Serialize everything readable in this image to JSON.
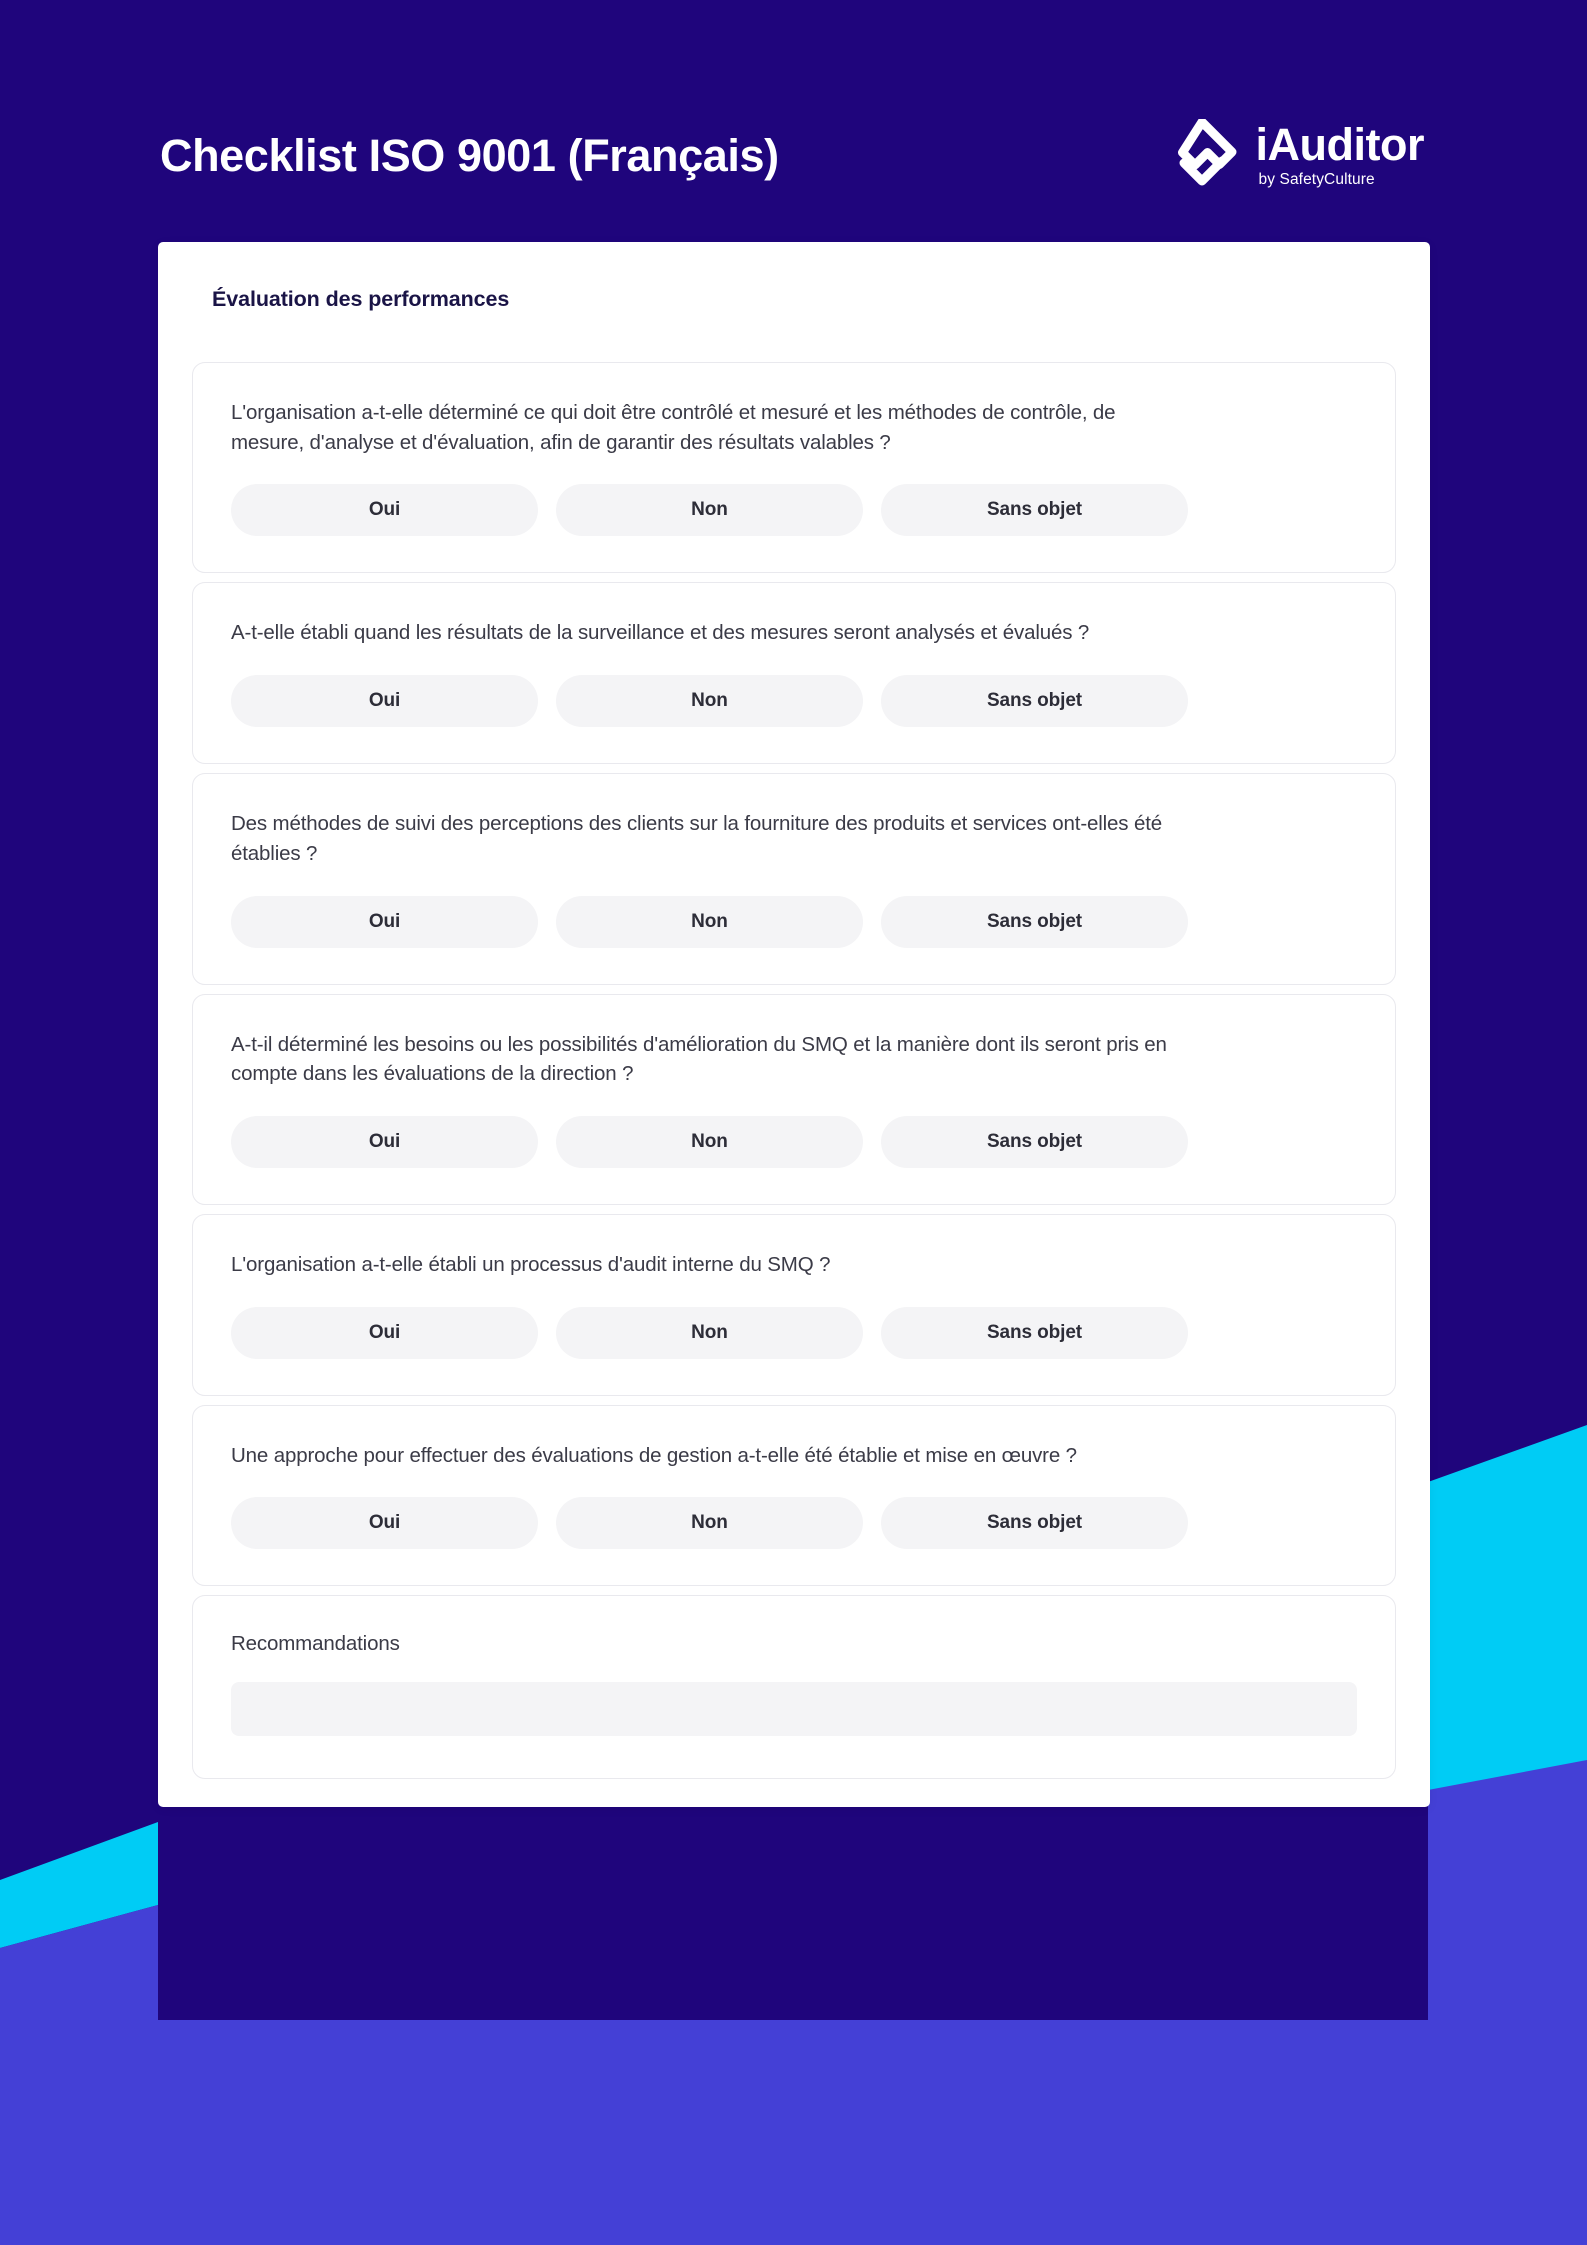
{
  "theme": {
    "background_dark": "#1F057C",
    "accent_cyan": "#00CCF5",
    "accent_blue": "#4440D6",
    "sheet_background": "#FFFFFF",
    "option_background": "#F4F4F6",
    "text_color": "#3B3B47",
    "title_color": "#1A1446"
  },
  "header": {
    "title": "Checklist ISO 9001 (Français)",
    "brand": {
      "mark": "diamond-check-icon",
      "name": "iAuditor",
      "tagline": "by SafetyCulture"
    }
  },
  "sheet": {
    "section_title": "Évaluation des performances",
    "answer_options": [
      "Oui",
      "Non",
      "Sans objet"
    ],
    "questions": [
      {
        "text": "L'organisation a-t-elle déterminé ce qui doit être contrôlé et mesuré et les méthodes de contrôle, de mesure, d'analyse et d'évaluation, afin de garantir des résultats valables ?",
        "options": [
          "Oui",
          "Non",
          "Sans objet"
        ]
      },
      {
        "text": "A-t-elle établi quand les résultats de la surveillance et des mesures seront analysés et évalués ?",
        "options": [
          "Oui",
          "Non",
          "Sans objet"
        ]
      },
      {
        "text": "Des méthodes de suivi des perceptions des clients sur la fourniture des produits et services ont-elles été établies ?",
        "options": [
          "Oui",
          "Non",
          "Sans objet"
        ]
      },
      {
        "text": "A-t-il déterminé les besoins ou les possibilités d'amélioration du SMQ et la manière dont ils seront pris en compte dans les évaluations de la direction ?",
        "options": [
          "Oui",
          "Non",
          "Sans objet"
        ]
      },
      {
        "text": "L'organisation a-t-elle établi un processus d'audit interne du SMQ ?",
        "options": [
          "Oui",
          "Non",
          "Sans objet"
        ]
      },
      {
        "text": "Une approche pour effectuer des évaluations de gestion a-t-elle été établie et mise en œuvre ?",
        "options": [
          "Oui",
          "Non",
          "Sans objet"
        ]
      }
    ],
    "recommendations": {
      "label": "Recommandations",
      "value": "",
      "placeholder": ""
    }
  }
}
